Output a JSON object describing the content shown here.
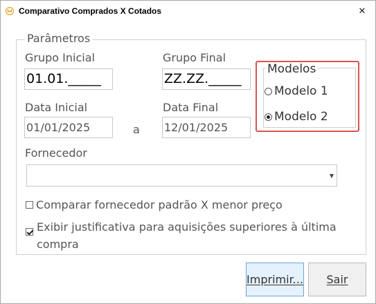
{
  "window": {
    "title": "Comparativo Comprados X Cotados",
    "close_glyph": "✕"
  },
  "params": {
    "legend": "Parâmetros",
    "grupo_inicial": {
      "label": "Grupo Inicial",
      "value": "01.01._____"
    },
    "grupo_final": {
      "label": "Grupo Final",
      "value": "ZZ.ZZ._____"
    },
    "data_inicial": {
      "label": "Data Inicial",
      "value": "01/01/2025"
    },
    "separator": "a",
    "data_final": {
      "label": "Data Final",
      "value": "12/01/2025"
    },
    "modelos": {
      "legend": "Modelos",
      "options": [
        {
          "label": "Modelo 1",
          "checked": false
        },
        {
          "label": "Modelo 2",
          "checked": true
        }
      ]
    },
    "fornecedor": {
      "label": "Fornecedor",
      "value": ""
    },
    "check_comparar": {
      "label": "Comparar fornecedor padrão X menor preço",
      "checked": false
    },
    "check_exibir": {
      "label": "Exibir justificativa para aquisições superiores à última compra",
      "checked": true
    }
  },
  "buttons": {
    "imprimir": "Imprimir...",
    "sair": "Sair"
  },
  "colors": {
    "highlight_border": "#d9534f",
    "primary_button_bg": "#e5f1fb",
    "primary_button_border": "#6aa5d9"
  },
  "icons": {
    "app": "shopping-cart-icon",
    "close": "close-icon",
    "dropdown": "chevron-down-icon"
  }
}
